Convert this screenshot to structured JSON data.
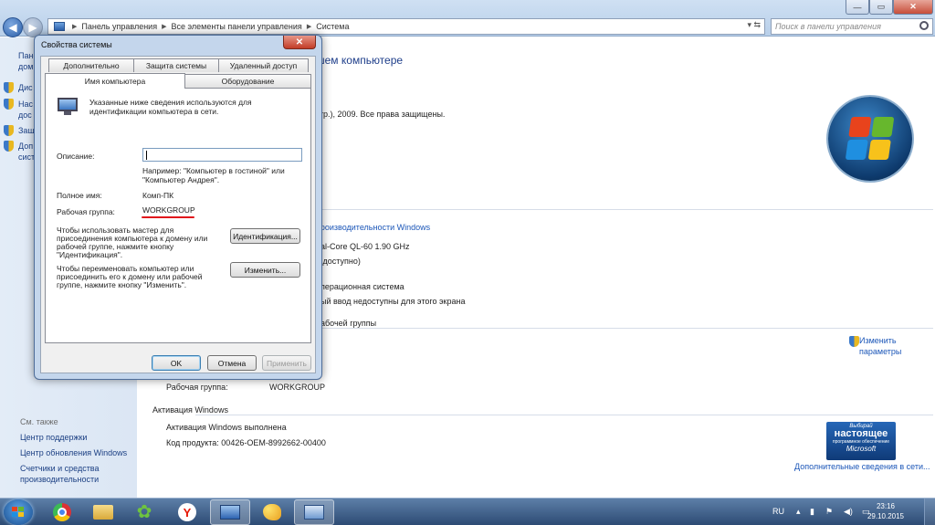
{
  "explorer": {
    "breadcrumb": [
      "Панель управления",
      "Все элементы панели управления",
      "Система"
    ],
    "search_placeholder": "Поиск в панели управления",
    "window_controls": {
      "minimize": "—",
      "maximize": "▭",
      "close": "✕"
    },
    "sidebar": {
      "items": [
        {
          "label": "Пане"
        },
        {
          "label": "дом"
        },
        {
          "label": "Дис"
        },
        {
          "label": "Нас"
        },
        {
          "label": "дос"
        },
        {
          "label": "Защ"
        },
        {
          "label": "Доп"
        },
        {
          "label": "сист"
        }
      ],
      "see_also": "См. также",
      "bottom_links": [
        "Центр поддержки",
        "Центр обновления Windows",
        "Счетчики и средства",
        "производительности"
      ]
    },
    "main": {
      "header": "шем компьютере",
      "copyright": "orp.), 2009. Все права защищены.",
      "perf_link": "производительности Windows",
      "cpu": "ual-Core QL-60   1.90 GHz",
      "ram": "5 доступно)",
      "os_type": "операционная система",
      "pen": "ный ввод недоступны для этого экрана",
      "group_header": "рабочей группы",
      "change_settings": [
        "Изменить",
        "параметры"
      ],
      "workgroup_label": "Рабочая группа:",
      "workgroup_value": "WORKGROUP",
      "activation_header": "Активация Windows",
      "activation_status": "Активация Windows выполнена",
      "product_id": "Код продукта: 00426-OEM-8992662-00400",
      "more_link": "Дополнительные сведения в сети...",
      "genuine": [
        "Выбирай",
        "настоящее",
        "программное обеспечение",
        "Microsoft"
      ]
    }
  },
  "dialog": {
    "title": "Свойства системы",
    "close": "✕",
    "tabs_row1": [
      "Дополнительно",
      "Защита системы",
      "Удаленный доступ"
    ],
    "tabs_row2": [
      "Имя компьютера",
      "Оборудование"
    ],
    "intro": [
      "Указанные ниже сведения используются для",
      "идентификации компьютера в сети."
    ],
    "description_label": "Описание:",
    "description_value": "",
    "example": [
      "Например: \"Компьютер в гостиной\" или",
      "\"Компьютер Андрея\"."
    ],
    "full_name_label": "Полное имя:",
    "full_name_value": "Комп-ПК",
    "workgroup_label": "Рабочая группа:",
    "workgroup_value": "WORKGROUP",
    "wizard_text": [
      "Чтобы использовать мастер для",
      "присоединения компьютера к домену или",
      "рабочей группе, нажмите кнопку",
      "\"Идентификация\"."
    ],
    "identify_button": "Идентификация...",
    "rename_text": [
      "Чтобы переименовать компьютер или",
      "присоединить его к домену или рабочей",
      "группе, нажмите кнопку \"Изменить\"."
    ],
    "change_button": "Изменить...",
    "ok": "OK",
    "cancel": "Отмена",
    "apply": "Применить"
  },
  "taskbar": {
    "lang": "RU",
    "time": "23:16",
    "date": "29.10.2015",
    "apps": [
      "explorer-icon",
      "chrome-icon",
      "folder-icon",
      "icq-icon",
      "yandex-browser-icon",
      "control-panel-icon",
      "paint-icon",
      "system-properties-icon"
    ]
  }
}
